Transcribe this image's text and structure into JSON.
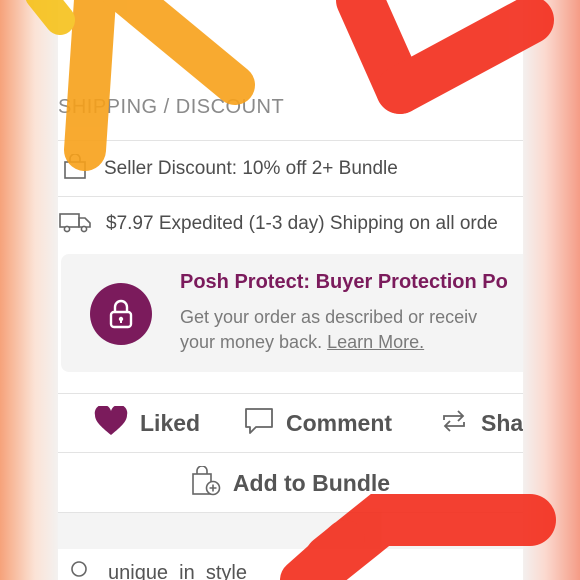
{
  "section": {
    "title": "SHIPPING / DISCOUNT"
  },
  "discount": {
    "icon": "shopping-bag-icon",
    "text": "Seller Discount: 10% off 2+ Bundle"
  },
  "shipping": {
    "icon": "truck-icon",
    "text": "$7.97 Expedited (1-3 day) Shipping on all orde"
  },
  "protect": {
    "icon": "lock-icon",
    "title": "Posh Protect: Buyer Protection Po",
    "desc_line1": "Get your order as described or receiv",
    "desc_line2_prefix": "your money back.",
    "learn_more": "Learn More."
  },
  "actions": {
    "liked": "Liked",
    "comment": "Comment",
    "share": "Sha"
  },
  "bundle": {
    "label": "Add to Bundle"
  },
  "footer": {
    "text": "unique_in_style"
  },
  "colors": {
    "brand": "#7b1b5c",
    "sticker_orange": "#f7a11a",
    "sticker_red": "#f2301f"
  }
}
